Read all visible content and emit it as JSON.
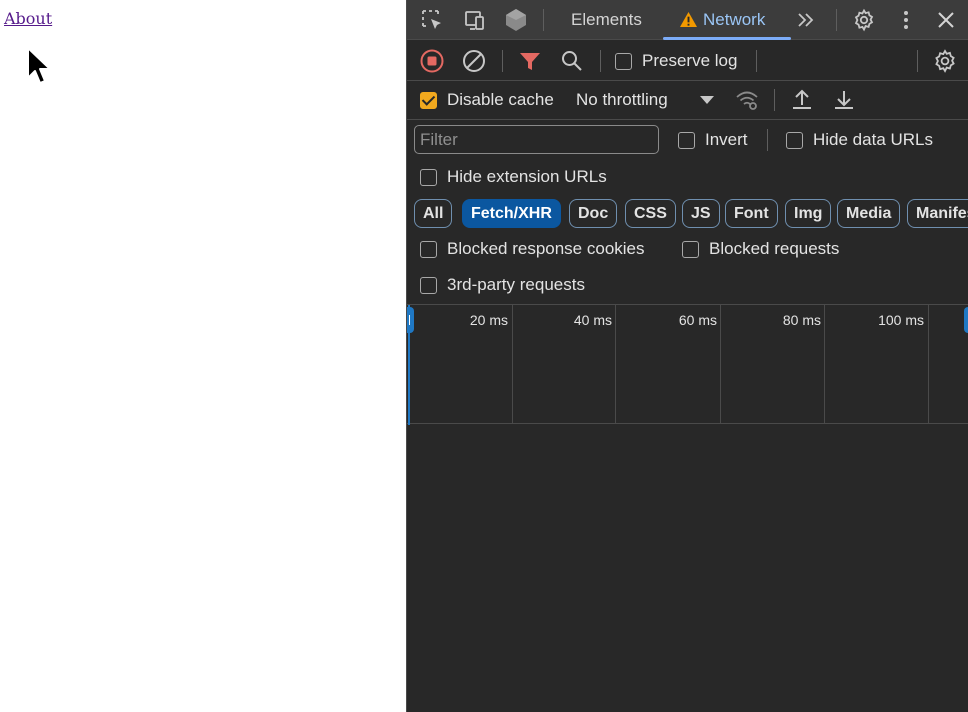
{
  "page": {
    "link_text": "About"
  },
  "devtools": {
    "tabs": {
      "elements": "Elements",
      "network": "Network"
    },
    "toolbar": {
      "preserve_log": "Preserve log",
      "disable_cache": "Disable cache",
      "throttling": "No throttling",
      "preserve_log_checked": false,
      "disable_cache_checked": true
    },
    "filter": {
      "placeholder": "Filter",
      "invert": "Invert",
      "hide_data_urls": "Hide data URLs",
      "hide_extension_urls": "Hide extension URLs"
    },
    "type_filters": [
      "All",
      "Fetch/XHR",
      "Doc",
      "CSS",
      "JS",
      "Font",
      "Img",
      "Media",
      "Manifest"
    ],
    "active_type_filter": "Fetch/XHR",
    "blocked": {
      "blocked_response_cookies": "Blocked response cookies",
      "blocked_requests": "Blocked requests",
      "third_party": "3rd-party requests"
    },
    "timeline": {
      "ticks": [
        "20 ms",
        "40 ms",
        "60 ms",
        "80 ms",
        "100 ms"
      ]
    },
    "colors": {
      "accent": "#7cacf8",
      "checkbox": "#f2a91e",
      "record": "#e46962",
      "active_chip": "#0b57a0",
      "warning": "#f29900"
    }
  }
}
